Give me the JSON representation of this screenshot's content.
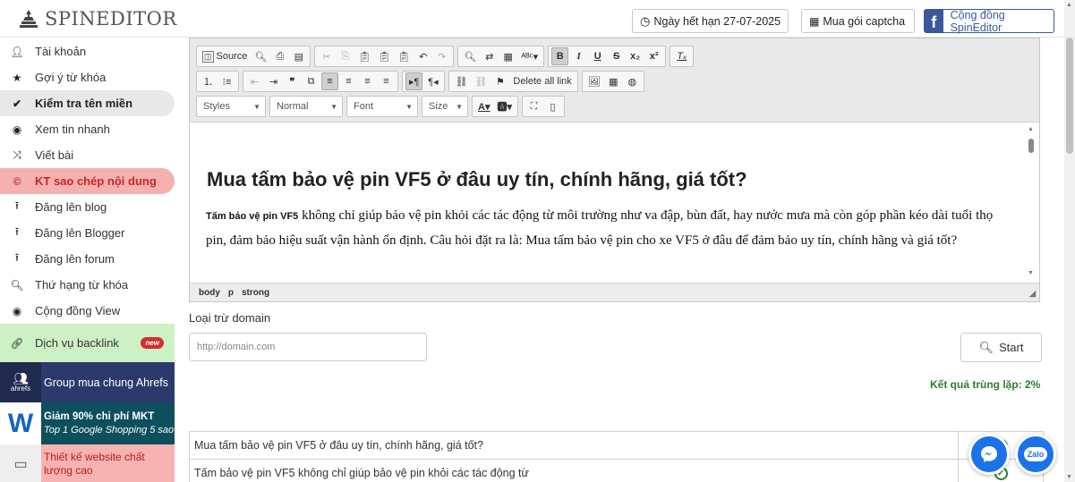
{
  "header": {
    "logo_text": "SPINEDITOR",
    "expiry_label": "Ngày hết hạn 27-07-2025",
    "captcha_label": "Mua gói captcha",
    "community_label": "Cộng đồng SpinEditor"
  },
  "sidebar": {
    "items": [
      {
        "label": "Tài khoản",
        "icon": "user-icon"
      },
      {
        "label": "Gợi ý từ khóa",
        "icon": "star-icon"
      },
      {
        "label": "Kiểm tra tên miền",
        "icon": "check-icon"
      },
      {
        "label": "Xem tin nhanh",
        "icon": "eye-icon"
      },
      {
        "label": "Viết bài",
        "icon": "shuffle-icon"
      },
      {
        "label": "KT sao chép nội dung",
        "icon": "copyright-icon"
      },
      {
        "label": "Đăng lên blog",
        "icon": "upload-icon"
      },
      {
        "label": "Đăng lên Blogger",
        "icon": "upload-icon"
      },
      {
        "label": "Đăng lên forum",
        "icon": "upload-icon"
      },
      {
        "label": "Thứ hạng từ khóa",
        "icon": "search-icon"
      },
      {
        "label": "Cộng đồng View",
        "icon": "eye-icon"
      }
    ],
    "backlink_label": "Dịch vụ backlink",
    "backlink_badge": "new",
    "promo_ahrefs": "Group mua chung Ahrefs",
    "promo_ahrefs_logo": "ahrefs",
    "promo_mkt_title": "Giảm 90% chi phí MKT",
    "promo_mkt_sub": "Top 1 Google Shopping 5 sao",
    "promo_web": "Thiết kế website chất lượng cao"
  },
  "editor": {
    "source_label": "Source",
    "delete_links_label": "Delete all link",
    "styles_label": "Styles",
    "format_label": "Normal",
    "font_label": "Font",
    "size_label": "Size",
    "heading": "Mua tấm bảo vệ pin VF5 ở đâu uy tín, chính hãng, giá tốt?",
    "para_strong": "Tấm bảo vệ pin VF5",
    "para_rest": " không chỉ giúp bảo vệ pin khỏi các tác động từ môi trường như va đập, bùn đất, hay nước mưa mà còn góp phần kéo dài tuổi thọ pin, đảm bảo hiệu suất vận hành ổn định. Câu hỏi đặt ra là: Mua tấm bảo vệ pin cho xe VF5 ở đâu để đảm bảo uy tín, chính hãng và giá tốt?",
    "path": [
      "body",
      "p",
      "strong"
    ]
  },
  "exclude": {
    "label": "Loại trừ domain",
    "placeholder": "http://domain.com",
    "start_label": "Start"
  },
  "result_label": "Kết quả trùng lặp: 2%",
  "results": [
    {
      "text": "Mua tấm bảo vệ pin VF5 ở đâu uy tín, chính hãng, giá tốt?"
    },
    {
      "text": "Tấm bảo vệ pin VF5 không chỉ giúp bảo vệ pin khỏi các tác động từ"
    }
  ],
  "floating": {
    "zalo_label": "Zalo"
  }
}
